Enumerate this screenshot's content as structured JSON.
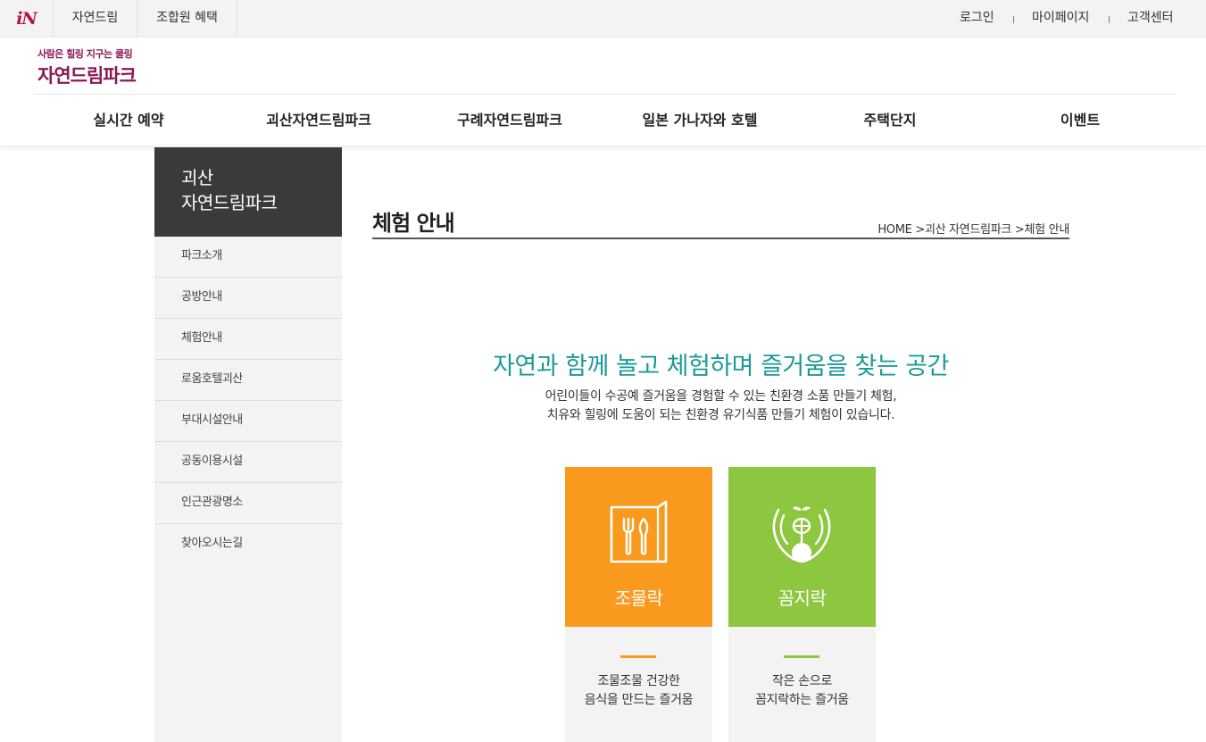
{
  "topbar": {
    "brand": "iN",
    "links": [
      "자연드림",
      "조합원 혜택"
    ],
    "util": [
      "로그인",
      "마이페이지",
      "고객센터"
    ]
  },
  "logo": {
    "tagline": "사람은 힐링 지구는 쿨링",
    "name": "자연드림파크"
  },
  "gnb": [
    "실시간 예약",
    "괴산자연드림파크",
    "구례자연드림파크",
    "일본 가나자와 호텔",
    "주택단지",
    "이벤트"
  ],
  "sidebar": {
    "title_line1": "괴산",
    "title_line2": "자연드림파크",
    "items": [
      "파크소개",
      "공방안내",
      "체험안내",
      "로움호텔괴산",
      "부대시설안내",
      "공동이용시설",
      "인근관광명소",
      "찾아오시는길"
    ]
  },
  "content": {
    "title": "체험 안내",
    "breadcrumb": "HOME >괴산 자연드림파크 >체험 안내",
    "intro_heading": "자연과 함께 놀고 체험하며 즐거움을 찾는 공간",
    "intro_line1": "어린이들이 수공예 즐거움을 경험할 수 있는 친환경 소품 만들기 체험,",
    "intro_line2": "치유와 힐링에 도움이 되는 친환경 유기식품 만들기 체험이 있습니다."
  },
  "cards": [
    {
      "name": "조물락",
      "icon": "utensils-icon",
      "color": "#f99a1f",
      "desc1": "조물조물 건강한",
      "desc2": "음식을 만드는 즐거움"
    },
    {
      "name": "꼼지락",
      "icon": "sprout-hands-icon",
      "color": "#8dc63f",
      "desc1": "작은 손으로",
      "desc2": "꼼지락하는 즐거움"
    }
  ]
}
